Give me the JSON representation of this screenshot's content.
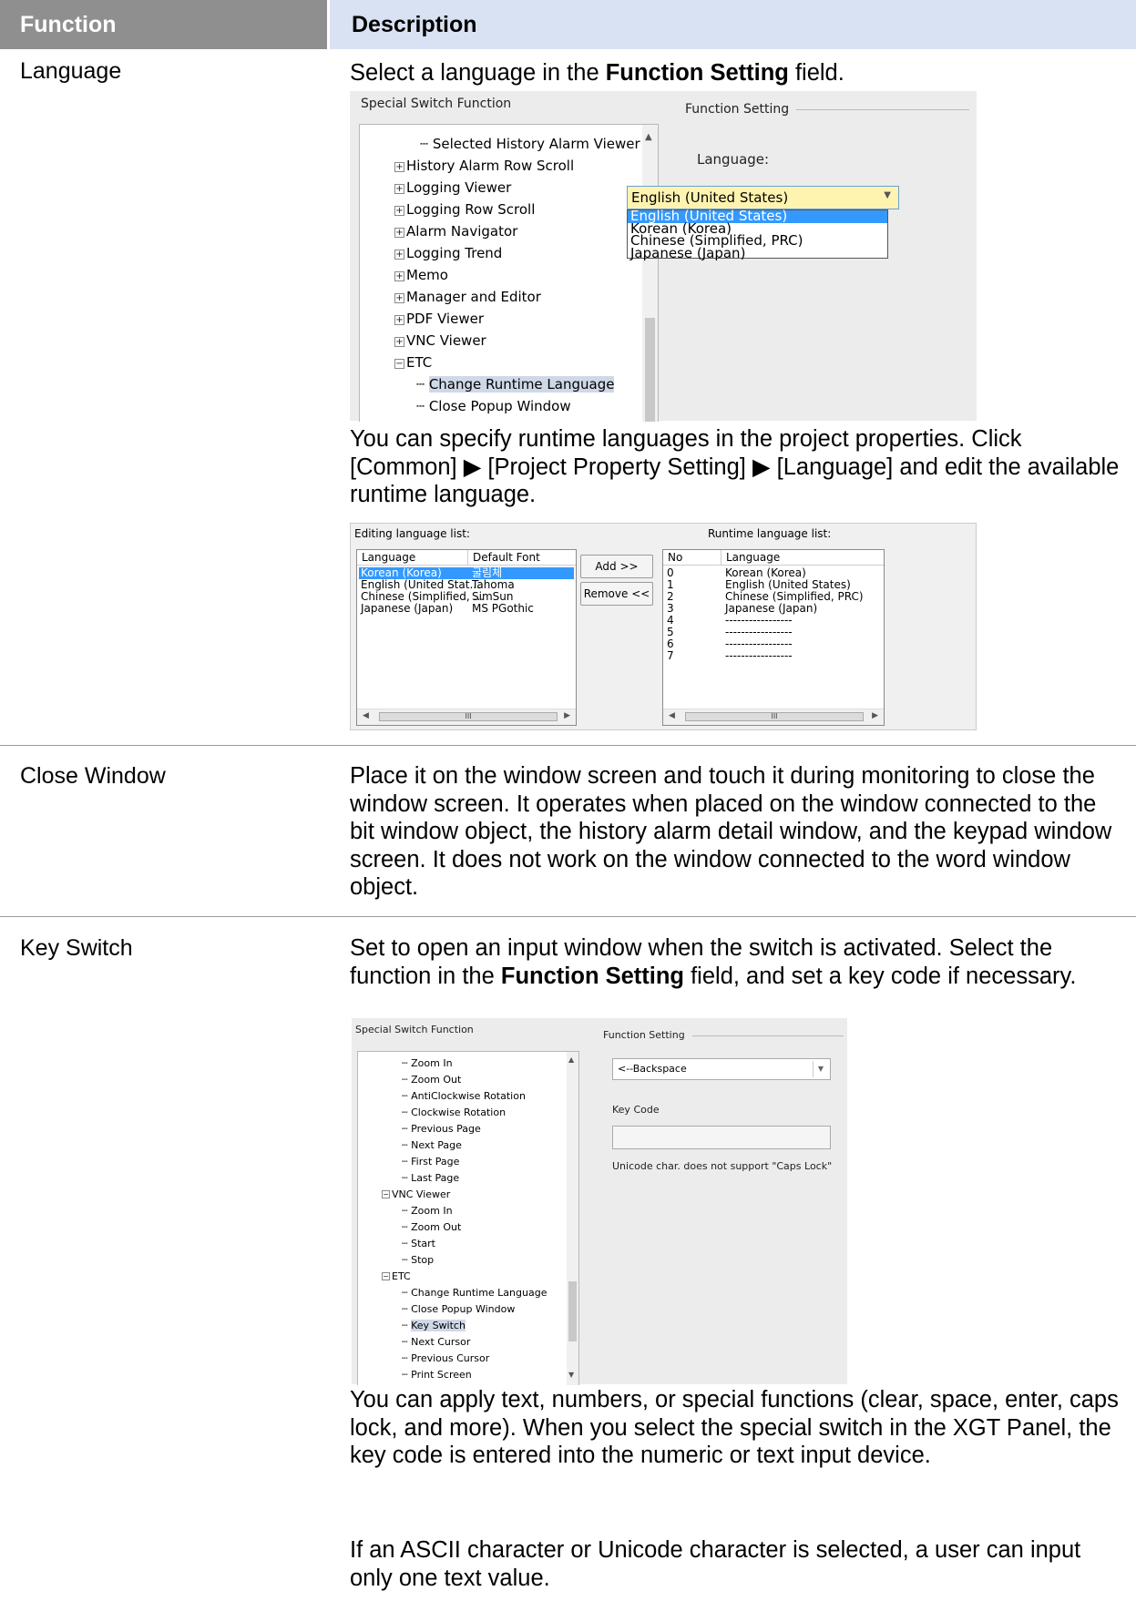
{
  "table": {
    "header_function": "Function",
    "header_description": "Description"
  },
  "rows": {
    "language": {
      "function": "Language",
      "intro_pre": "Select a language in the ",
      "intro_bold": "Function Setting",
      "intro_post": " field.",
      "para2": "You can specify runtime languages in the project properties. Click [Common] ▶ [Project Property Setting] ▶ [Language] and edit the available runtime language."
    },
    "close_window": {
      "function": "Close Window",
      "text": "Place it on the window screen and touch it during monitoring to close the window screen. It operates when placed on the window connected to the bit window object, the history alarm detail window, and the keypad window screen. It does not work on the window connected to the word window object."
    },
    "key_switch": {
      "function": "Key Switch",
      "intro_pre": "Set to open an input window when the switch is activated. Select the function in the ",
      "intro_bold": "Function Setting",
      "intro_post": " field, and set a key code if necessary.",
      "para2": "You can apply text, numbers, or special functions (clear, space, enter, caps lock, and more). When you select the special switch in the XGT Panel, the key code is entered into the numeric or text input device.",
      "para3": "If an ASCII character or Unicode character is selected, a user can input only one text value."
    }
  },
  "shot1": {
    "tree_title": "Special Switch Function",
    "function_setting": "Function Setting",
    "language_label": "Language:",
    "combo_value": "English (United States)",
    "tree_items": [
      "Selected History Alarm Viewer L",
      "History Alarm Row Scroll",
      "Logging Viewer",
      "Logging Row Scroll",
      "Alarm Navigator",
      "Logging Trend",
      "Memo",
      "Manager and Editor",
      "PDF Viewer",
      "VNC Viewer",
      "ETC",
      "Change Runtime Language",
      "Close Popup Window"
    ],
    "options": [
      "English (United States)",
      "Korean (Korea)",
      "Chinese (Simplified, PRC)",
      "Japanese (Japan)"
    ]
  },
  "shot2": {
    "editing_label": "Editing language list:",
    "runtime_label": "Runtime language list:",
    "col_language": "Language",
    "col_default_font": "Default Font",
    "col_no": "No",
    "col_language2": "Language",
    "editing_rows": [
      {
        "language": "Korean (Korea)",
        "font": "굴림체"
      },
      {
        "language": "English (United Stat...",
        "font": "Tahoma"
      },
      {
        "language": "Chinese (Simplified, ...",
        "font": "SimSun"
      },
      {
        "language": "Japanese (Japan)",
        "font": "MS PGothic"
      }
    ],
    "runtime_rows": [
      {
        "no": "0",
        "language": "Korean (Korea)"
      },
      {
        "no": "1",
        "language": "English (United States)"
      },
      {
        "no": "2",
        "language": "Chinese (Simplified, PRC)"
      },
      {
        "no": "3",
        "language": "Japanese (Japan)"
      },
      {
        "no": "4",
        "language": "-----------------"
      },
      {
        "no": "5",
        "language": "-----------------"
      },
      {
        "no": "6",
        "language": "-----------------"
      },
      {
        "no": "7",
        "language": "-----------------"
      }
    ],
    "add_button": "Add >>",
    "remove_button": "Remove <<",
    "scroll_grip": "III"
  },
  "shot3": {
    "tree_title": "Special Switch Function",
    "function_setting": "Function Setting",
    "combo_value": "<--Backspace",
    "key_code_label": "Key Code",
    "note": "Unicode char. does not support \"Caps Lock\"",
    "tree_items": [
      "Zoom In",
      "Zoom Out",
      "AntiClockwise Rotation",
      "Clockwise Rotation",
      "Previous Page",
      "Next Page",
      "First Page",
      "Last Page",
      "VNC Viewer",
      "Zoom In",
      "Zoom Out",
      "Start",
      "Stop",
      "ETC",
      "Change Runtime Language",
      "Close Popup Window",
      "Key Switch",
      "Next Cursor",
      "Previous Cursor",
      "Print Screen"
    ]
  }
}
